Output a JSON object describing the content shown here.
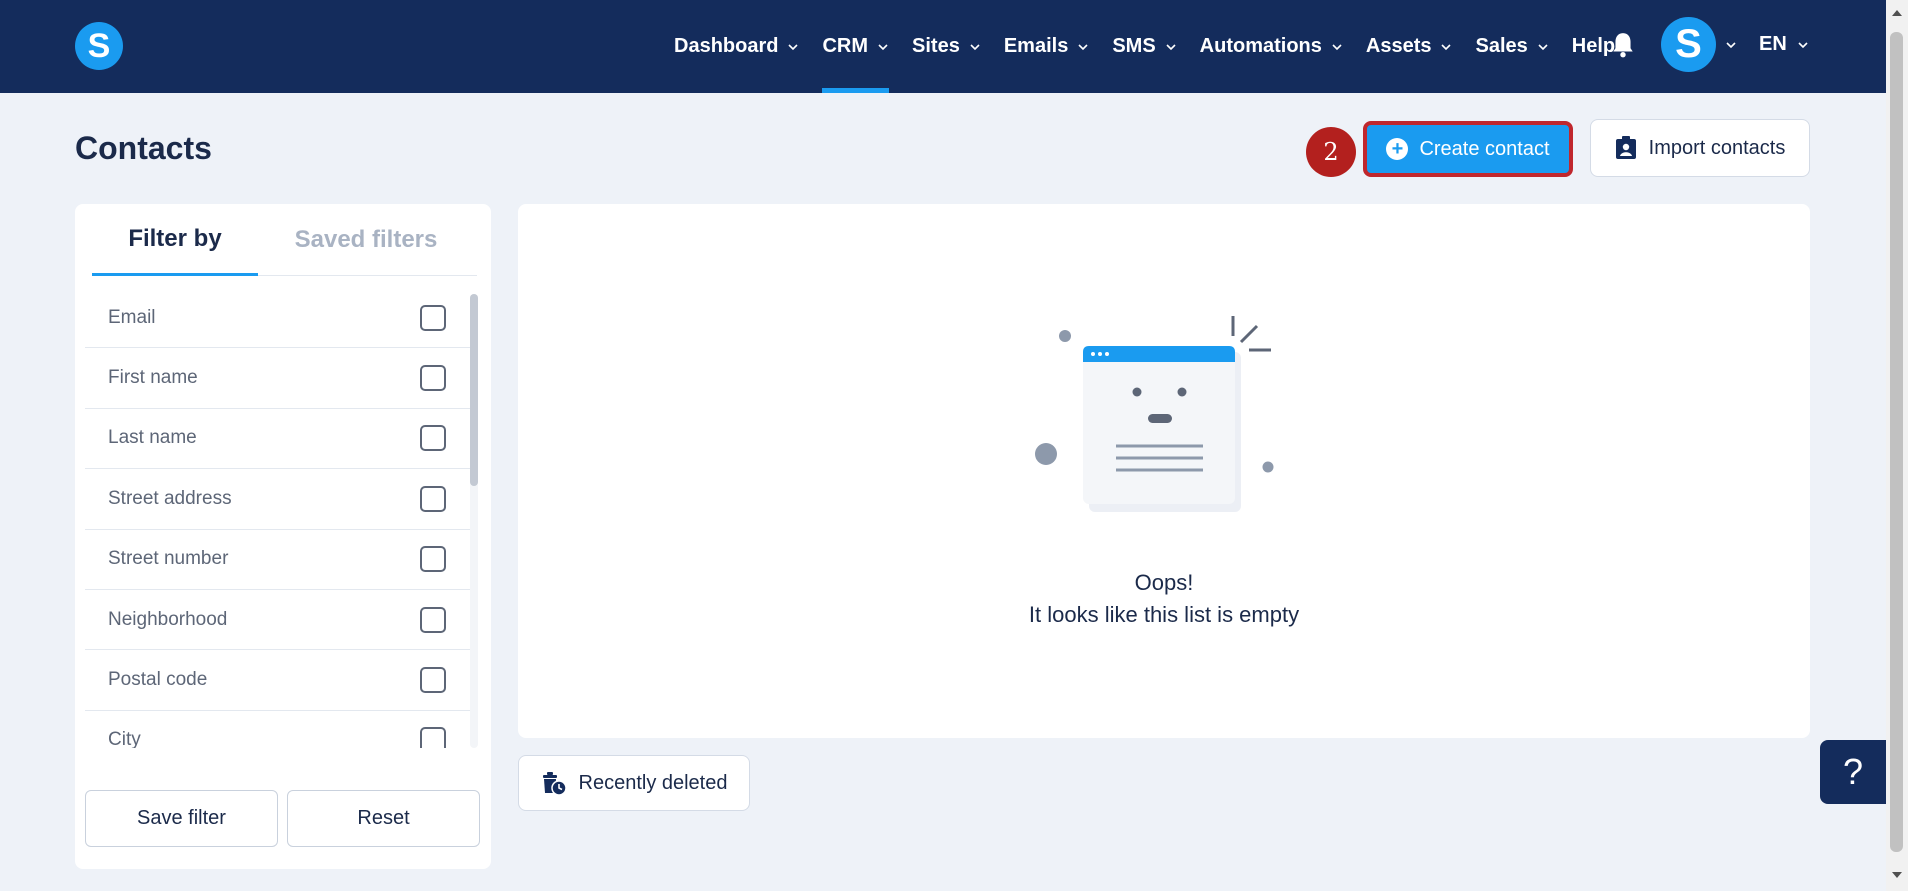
{
  "brand": {
    "logo_letter": "S"
  },
  "nav": {
    "items": [
      {
        "label": "Dashboard",
        "has_menu": true
      },
      {
        "label": "CRM",
        "has_menu": true,
        "active": true
      },
      {
        "label": "Sites",
        "has_menu": true
      },
      {
        "label": "Emails",
        "has_menu": true
      },
      {
        "label": "SMS",
        "has_menu": true
      },
      {
        "label": "Automations",
        "has_menu": true
      },
      {
        "label": "Assets",
        "has_menu": true
      },
      {
        "label": "Sales",
        "has_menu": true
      },
      {
        "label": "Help",
        "has_menu": false
      }
    ],
    "avatar_letter": "S",
    "language": "EN"
  },
  "page": {
    "title": "Contacts"
  },
  "toolbar": {
    "step_badge": "2",
    "create_label": "Create contact",
    "import_label": "Import contacts"
  },
  "filters": {
    "tabs": [
      "Filter by",
      "Saved filters"
    ],
    "items": [
      "Email",
      "First name",
      "Last name",
      "Street address",
      "Street number",
      "Neighborhood",
      "Postal code",
      "City"
    ],
    "save_label": "Save filter",
    "reset_label": "Reset"
  },
  "empty_state": {
    "title": "Oops!",
    "subtitle": "It looks like this list is empty"
  },
  "recently_deleted_label": "Recently deleted",
  "help_fab_label": "?",
  "colors": {
    "navy": "#142c5c",
    "accent": "#1a9bf0",
    "highlight_red": "#c0272d"
  }
}
